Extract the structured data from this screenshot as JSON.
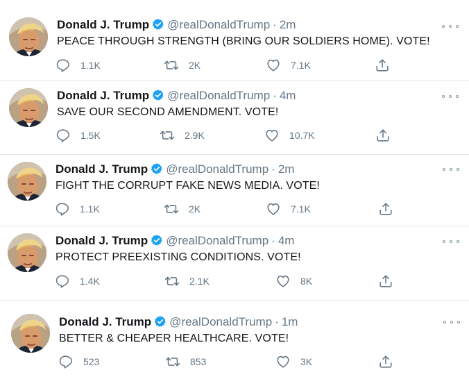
{
  "tweets": [
    {
      "name": "Donald J. Trump",
      "handle": "@realDonaldTrump",
      "time": "2m",
      "text": "PEACE THROUGH STRENGTH (BRING OUR SOLDIERS HOME). VOTE!",
      "replies": "1.1K",
      "retweets": "2K",
      "likes": "7.1K"
    },
    {
      "name": "Donald J. Trump",
      "handle": "@realDonaldTrump",
      "time": "4m",
      "text": "SAVE OUR SECOND AMENDMENT. VOTE!",
      "replies": "1.5K",
      "retweets": "2.9K",
      "likes": "10.7K"
    },
    {
      "name": "Donald J. Trump",
      "handle": "@realDonaldTrump",
      "time": "2m",
      "text": "FIGHT THE CORRUPT FAKE NEWS MEDIA. VOTE!",
      "replies": "1.1K",
      "retweets": "2K",
      "likes": "7.1K"
    },
    {
      "name": "Donald J. Trump",
      "handle": "@realDonaldTrump",
      "time": "4m",
      "text": "PROTECT PREEXISTING CONDITIONS. VOTE!",
      "replies": "1.4K",
      "retweets": "2.1K",
      "likes": "8K"
    },
    {
      "name": "Donald J. Trump",
      "handle": "@realDonaldTrump",
      "time": "1m",
      "text": "BETTER & CHEAPER HEALTHCARE. VOTE!",
      "replies": "523",
      "retweets": "853",
      "likes": "3K"
    }
  ],
  "separator": "·",
  "colors": {
    "verified_blue": "#1da1f2",
    "secondary_text": "#657786",
    "divider": "#e1e8ed"
  },
  "icons": {
    "reply": "reply-icon",
    "retweet": "retweet-icon",
    "like": "like-icon",
    "share": "share-icon",
    "more": "more-icon",
    "verified": "verified-badge-icon"
  }
}
